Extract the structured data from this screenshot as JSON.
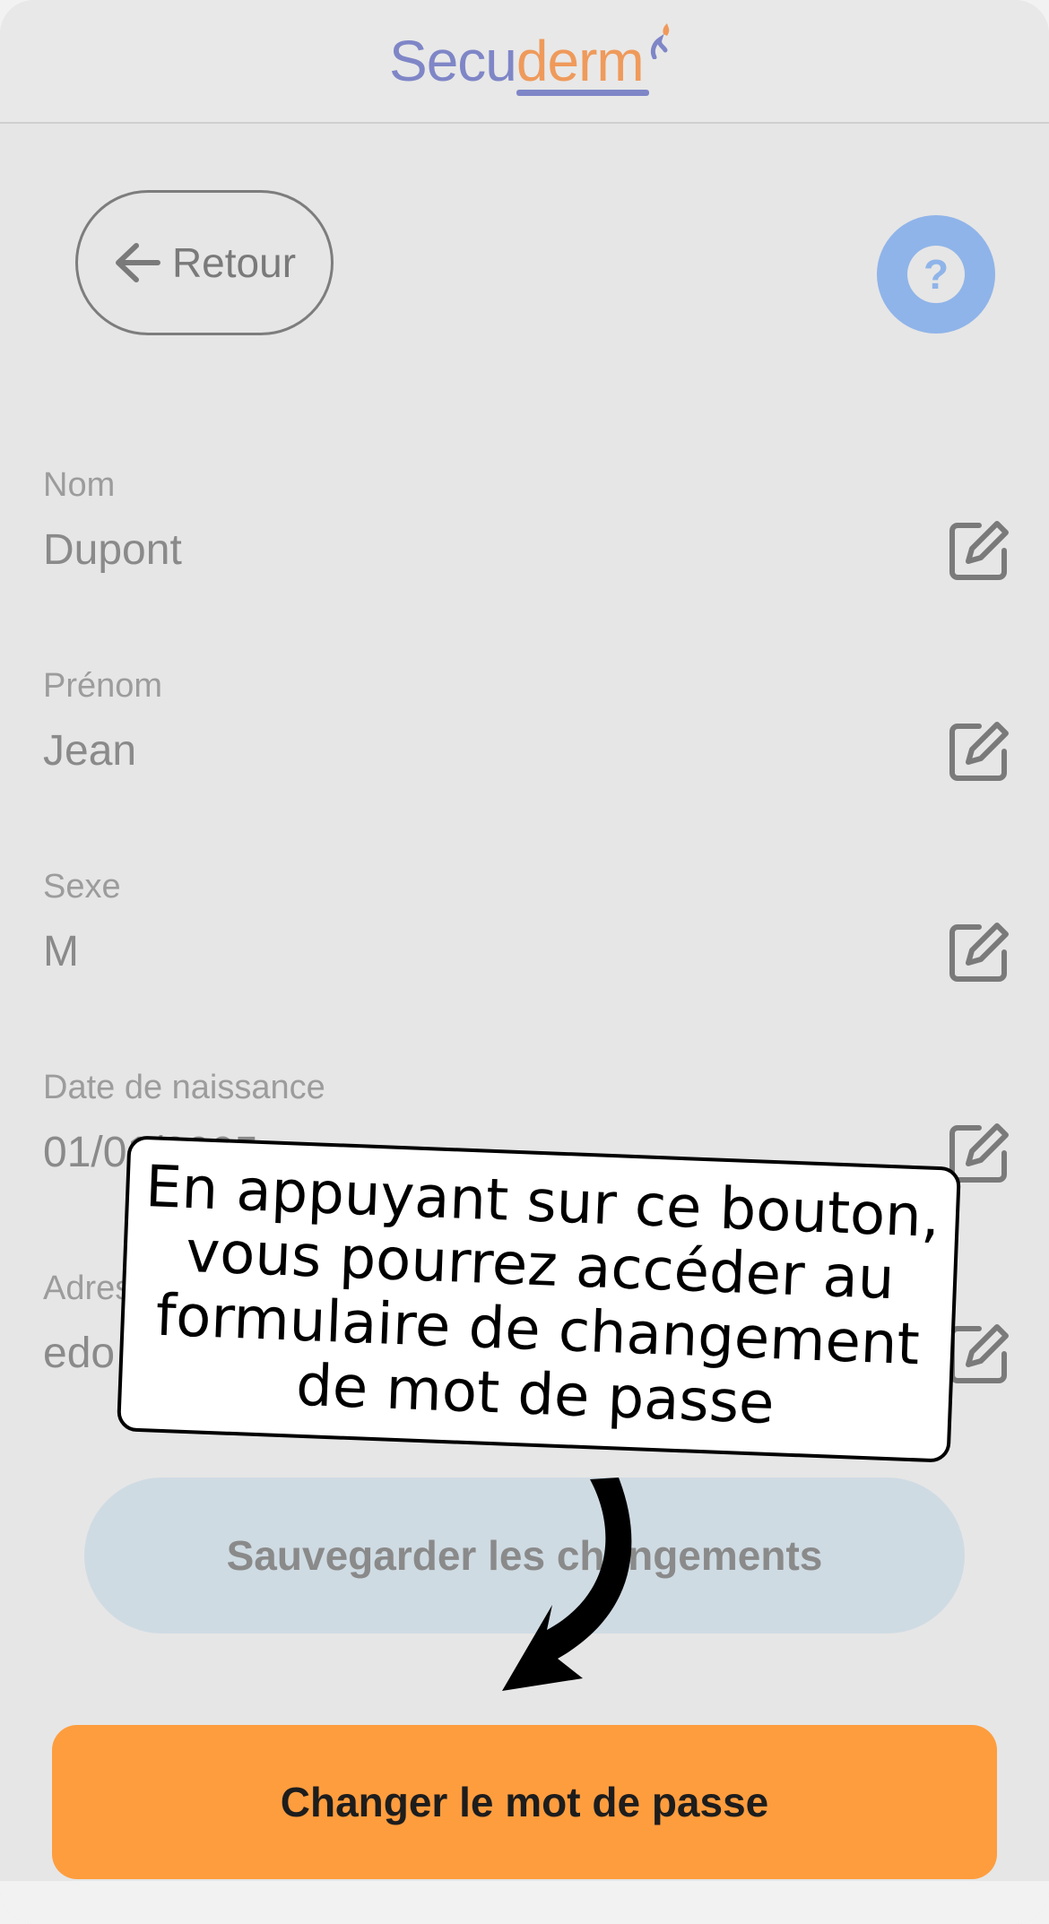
{
  "header": {
    "logo_part1": "Secu",
    "logo_part2": "derm"
  },
  "nav": {
    "back_label": "Retour",
    "help_symbol": "?"
  },
  "fields": [
    {
      "label": "Nom",
      "value": "Dupont"
    },
    {
      "label": "Prénom",
      "value": "Jean"
    },
    {
      "label": "Sexe",
      "value": "M"
    },
    {
      "label": "Date de naissance",
      "value": "01/01/2005"
    },
    {
      "label": "Adresse e-mail",
      "value": "edo"
    }
  ],
  "buttons": {
    "save_label": "Sauvegarder les changements",
    "change_password_label": "Changer le mot de passe"
  },
  "tutorial": {
    "tooltip_text": "En appuyant sur ce bouton, vous pourrez accéder au formulaire de changement de mot de passe"
  },
  "icons": {
    "back": "arrow-left-icon",
    "help": "question-icon",
    "edit": "edit-icon",
    "pointer": "curved-arrow-icon"
  },
  "colors": {
    "logo_blue": "#7f86c7",
    "logo_orange": "#ef9a5b",
    "help_blue": "#8fb4e9",
    "save_bg": "#cfdbe3",
    "change_bg": "#fe9d3e",
    "overlay_bg": "#e6e6e6"
  }
}
